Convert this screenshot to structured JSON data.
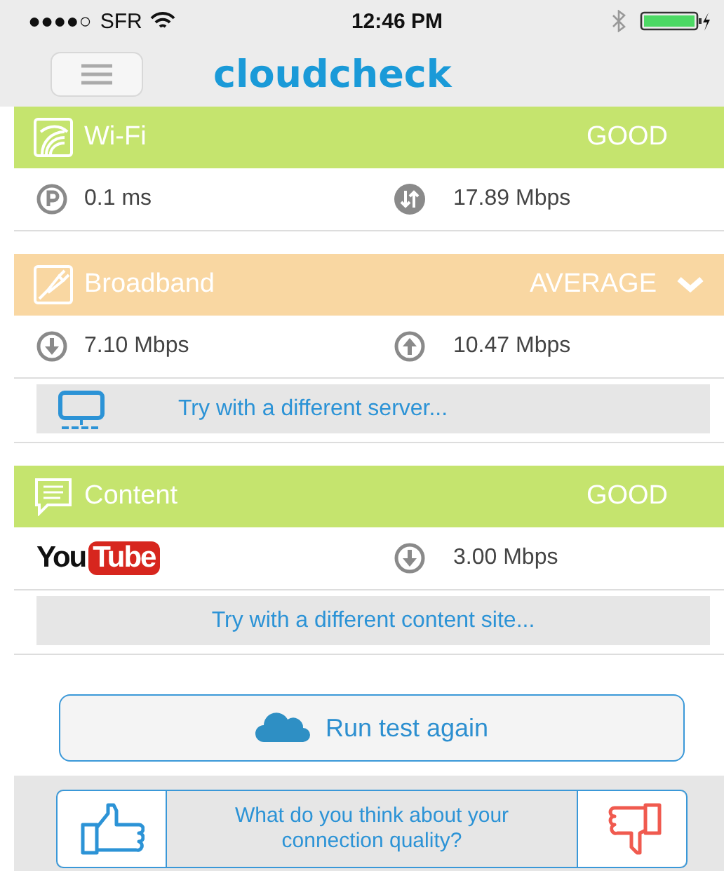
{
  "status_bar": {
    "signal": "●●●●○",
    "carrier": "SFR",
    "time": "12:46 PM"
  },
  "header": {
    "logo": "cloudcheck"
  },
  "sections": [
    {
      "kind": "wifi",
      "title": "Wi-Fi",
      "rating": "GOOD",
      "color": "#c5e46e",
      "dropdown": false,
      "metrics": [
        {
          "kind": "ping",
          "value": "0.1 ms"
        },
        {
          "kind": "transfer",
          "value": "17.89 Mbps"
        }
      ]
    },
    {
      "kind": "broadband",
      "title": "Broadband",
      "rating": "AVERAGE",
      "color": "#f9d7a2",
      "dropdown": true,
      "metrics": [
        {
          "kind": "download",
          "value": "7.10 Mbps"
        },
        {
          "kind": "upload",
          "value": "10.47 Mbps"
        }
      ],
      "action": {
        "kind": "server",
        "label": "Try with a different server..."
      }
    },
    {
      "kind": "content",
      "title": "Content",
      "rating": "GOOD",
      "color": "#c5e46e",
      "dropdown": false,
      "metrics": [
        {
          "kind": "logo",
          "parts": [
            "You",
            "Tube"
          ]
        },
        {
          "kind": "download",
          "value": "3.00 Mbps"
        }
      ],
      "action": {
        "kind": "content",
        "label": "Try with a different content site..."
      }
    }
  ],
  "run_button": {
    "label": "Run test again"
  },
  "feedback": {
    "question": "What do you think about your connection quality?"
  }
}
